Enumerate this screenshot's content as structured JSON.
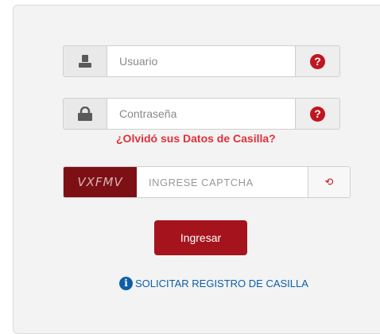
{
  "login": {
    "username_placeholder": "Usuario",
    "password_placeholder": "Contraseña",
    "forgot_link": "¿Olvidó sus Datos de Casilla?",
    "captcha_code": "VXFMV",
    "captcha_placeholder": "INGRESE CAPTCHA",
    "refresh_glyph": "⟲",
    "submit_label": "Ingresar",
    "register_link": "SOLICITAR REGISTRO DE CASILLA",
    "help_glyph": "?",
    "info_glyph": "i"
  },
  "icons": {
    "user": "user-icon",
    "lock": "lock-icon",
    "help": "question-icon",
    "refresh": "refresh-icon",
    "info": "info-icon"
  },
  "colors": {
    "accent": "#a5141c",
    "help": "#c0161f",
    "link_red": "#e0303a",
    "link_blue": "#0d5fa8",
    "captcha_bg": "#7c1015"
  }
}
